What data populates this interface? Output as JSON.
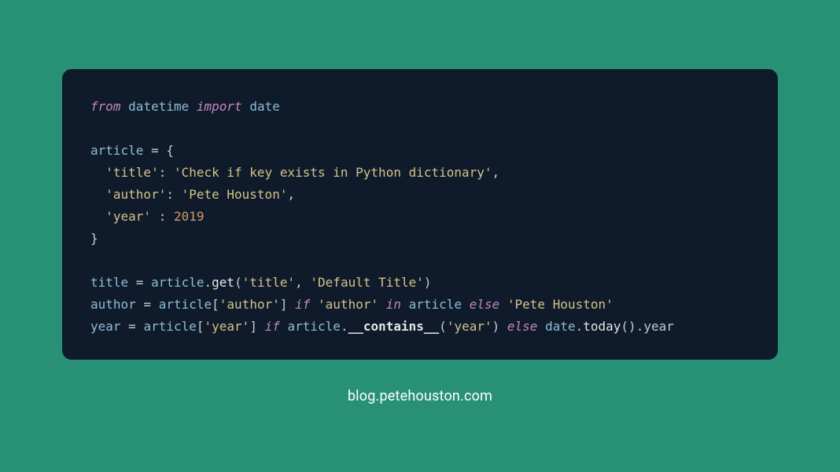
{
  "code": {
    "line1": {
      "from": "from",
      "mod": "datetime",
      "import": "import",
      "name": "date"
    },
    "line3": {
      "var": "article",
      "eq": " = ",
      "brace": "{"
    },
    "line4": {
      "indent": "  ",
      "key": "'title'",
      "colon": ": ",
      "val": "'Check if key exists in Python dictionary'",
      "comma": ","
    },
    "line5": {
      "indent": "  ",
      "key": "'author'",
      "colon": ": ",
      "val": "'Pete Houston'",
      "comma": ","
    },
    "line6": {
      "indent": "  ",
      "key": "'year'",
      "colon": " : ",
      "val": "2019"
    },
    "line7": {
      "brace": "}"
    },
    "line9": {
      "var": "title",
      "eq": " = ",
      "obj": "article",
      "dot": ".",
      "method": "get",
      "lp": "(",
      "a1": "'title'",
      "c": ", ",
      "a2": "'Default Title'",
      "rp": ")"
    },
    "line10": {
      "var": "author",
      "eq": " = ",
      "obj": "article",
      "lb": "[",
      "key": "'author'",
      "rb": "]",
      "sp": " ",
      "if": "if",
      "sp2": " ",
      "cond": "'author'",
      "sp3": " ",
      "in": "in",
      "sp4": " ",
      "obj2": "article",
      "sp5": " ",
      "else": "else",
      "sp6": " ",
      "alt": "'Pete Houston'"
    },
    "line11": {
      "var": "year",
      "eq": " = ",
      "obj": "article",
      "lb": "[",
      "key": "'year'",
      "rb": "]",
      "sp": " ",
      "if": "if",
      "sp2": " ",
      "obj2": "article",
      "dot": ".",
      "dunder": "__contains__",
      "lp": "(",
      "arg": "'year'",
      "rp": ")",
      "sp3": " ",
      "else": "else",
      "sp4": " ",
      "obj3": "date",
      "dot2": ".",
      "method": "today",
      "lp2": "(",
      "rp2": ")",
      "dot3": ".",
      "attr": "year"
    }
  },
  "attribution": "blog.petehouston.com"
}
